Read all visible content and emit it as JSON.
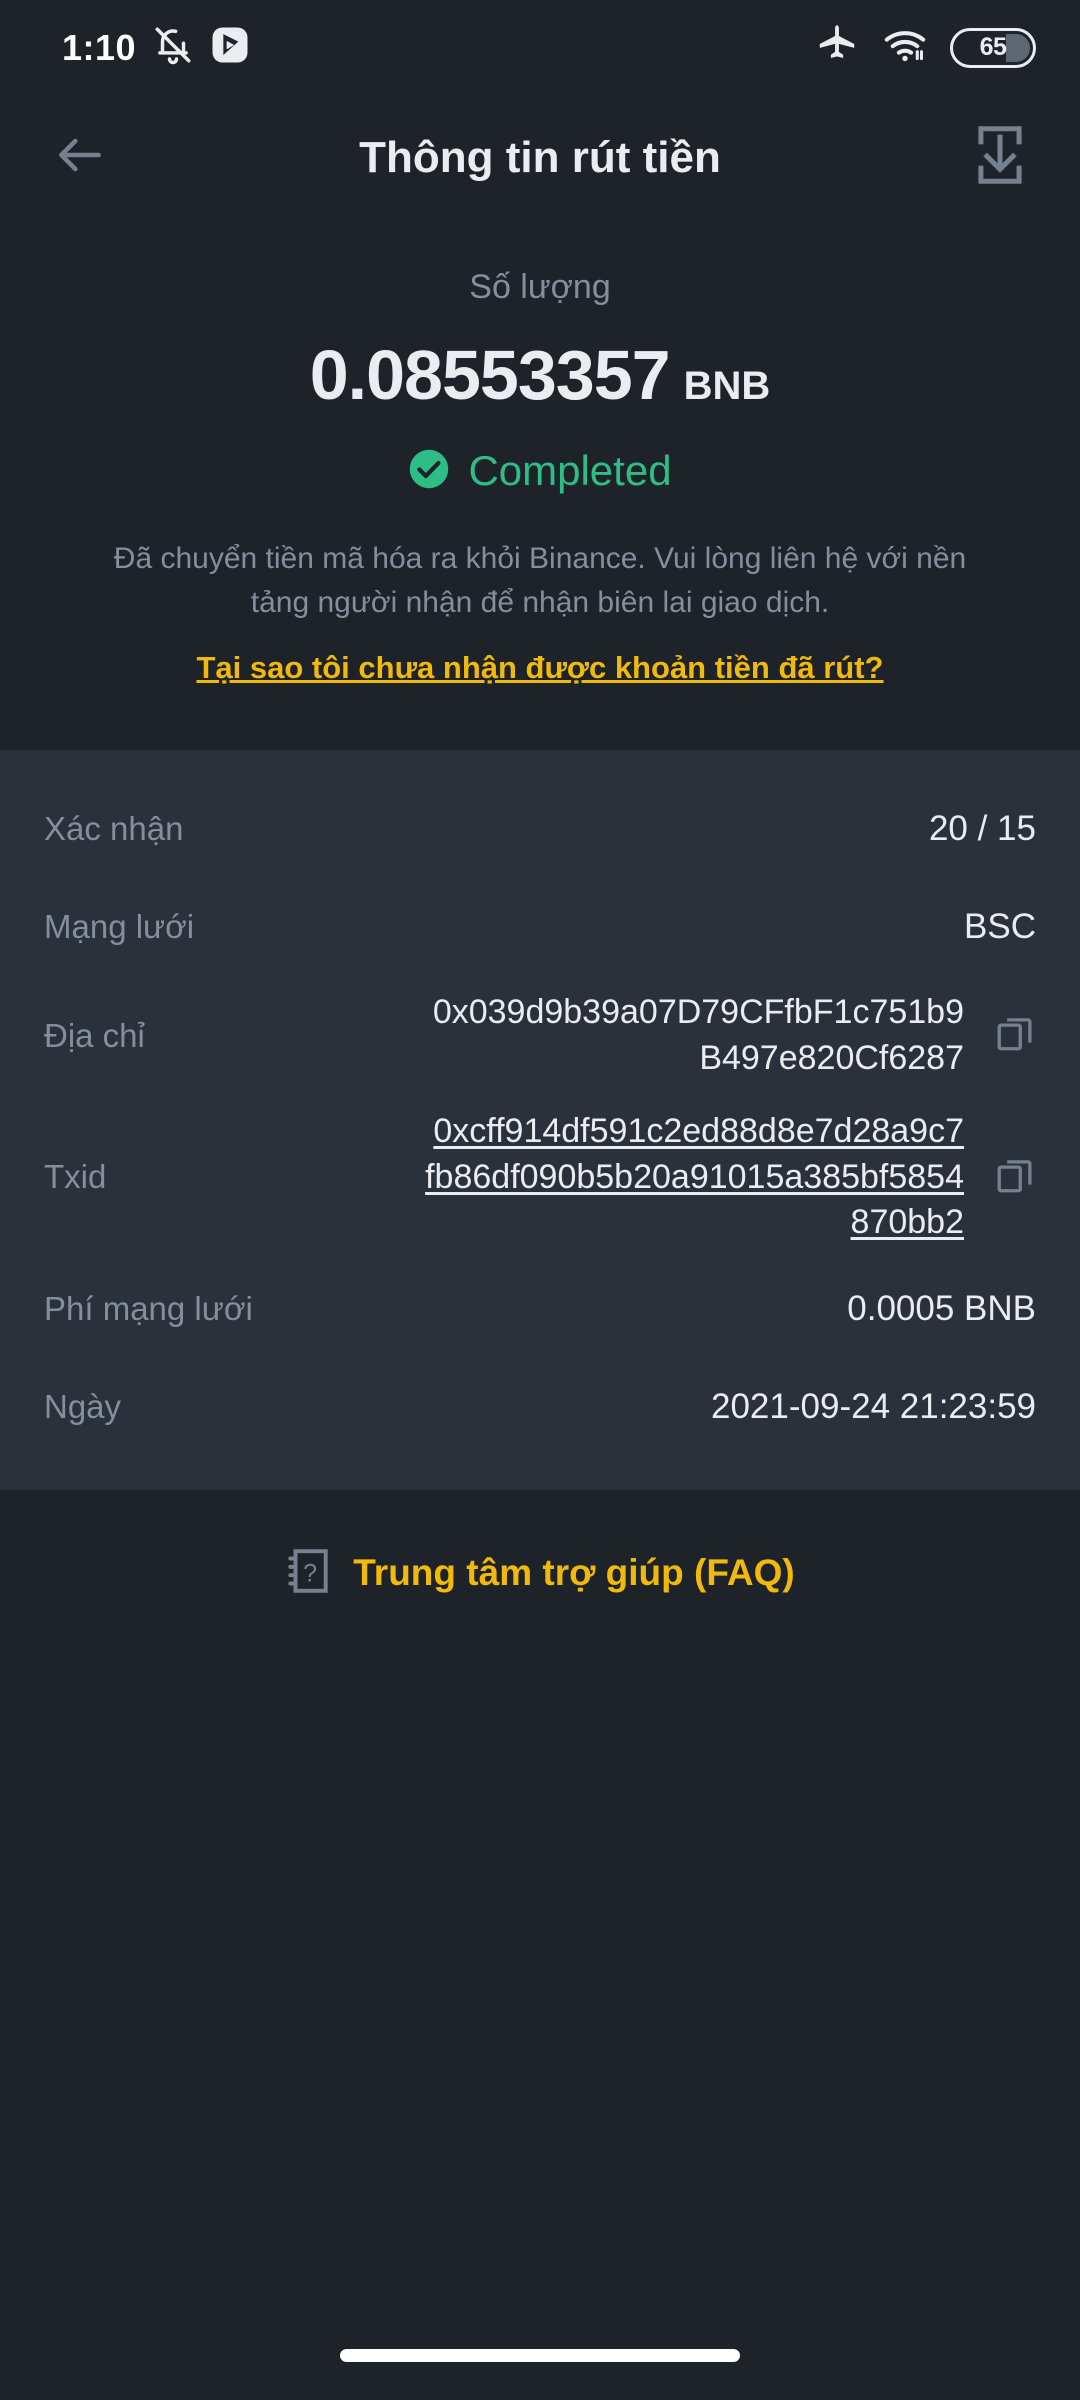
{
  "status_bar": {
    "time": "1:10",
    "icons": [
      "bell-muted-icon",
      "video-app-icon",
      "airplane-mode-icon",
      "wifi-icon"
    ],
    "battery_percent": "65"
  },
  "header": {
    "back_icon": "back-arrow-icon",
    "title": "Thông tin rút tiền",
    "save_icon": "save-download-icon"
  },
  "hero": {
    "amount_label": "Số lượng",
    "amount": "0.08553357",
    "unit": "BNB",
    "status_icon": "check-circle-icon",
    "status_text": "Completed",
    "status_color": "#2EBD85",
    "description": "Đã chuyển tiền mã hóa ra khỏi Binance. Vui lòng liên hệ với nền tảng người nhận để nhận biên lai giao dịch.",
    "help_link": "Tại sao tôi chưa nhận được khoản tiền đã rút?",
    "link_color": "#F0B90B"
  },
  "details": [
    {
      "label": "Xác nhận",
      "value": "20 / 15",
      "type": "text"
    },
    {
      "label": "Mạng lưới",
      "value": "BSC",
      "type": "text"
    },
    {
      "label": "Địa chỉ",
      "value": "0x039d9b39a07D79CFfbF1c751b9B497e820Cf6287",
      "type": "copy",
      "copy_icon": "copy-icon"
    },
    {
      "label": "Txid",
      "value": "0xcff914df591c2ed88d8e7d28a9c7fb86df090b5b20a91015a385bf5854870bb2",
      "type": "copy-link",
      "copy_icon": "copy-icon"
    },
    {
      "label": "Phí mạng lưới",
      "value": "0.0005 BNB",
      "type": "text"
    },
    {
      "label": "Ngày",
      "value": "2021-09-24 21:23:59",
      "type": "text"
    }
  ],
  "faq": {
    "icon": "help-book-icon",
    "label": "Trung tâm trợ giúp (FAQ)"
  },
  "theme": {
    "background": "#1E2329",
    "panel": "#2B313B",
    "text_primary": "#EAECEF",
    "text_secondary": "#848E9C",
    "accent_yellow": "#F0B90B",
    "accent_green": "#2EBD85"
  }
}
